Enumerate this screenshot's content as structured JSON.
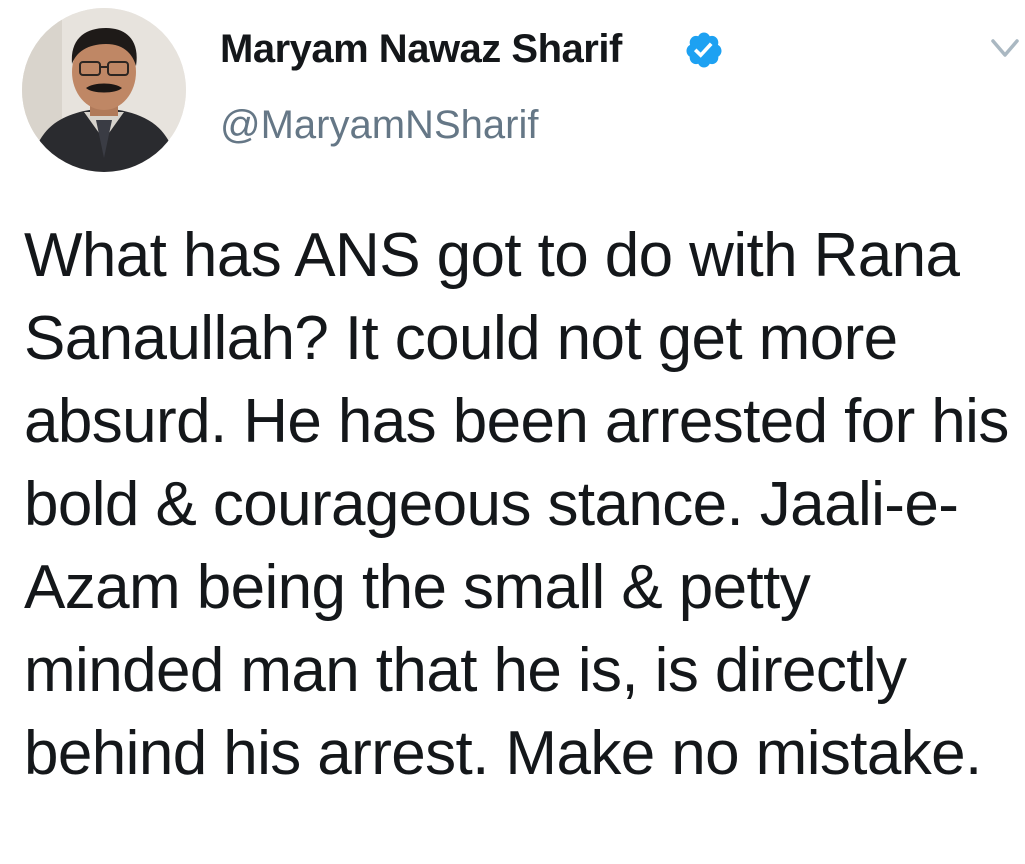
{
  "tweet": {
    "author": {
      "name": "Maryam Nawaz Sharif",
      "handle": "@MaryamNSharif",
      "verified": true
    },
    "text": "What has ANS got to do with Rana Sanaullah? It could not get more absurd. He has been arrested for his bold & courageous stance. Jaali-e-Azam being the small & petty minded man that he is, is directly behind his arrest. Make no mistake.",
    "icons": {
      "verified": "verified-badge-icon",
      "menu": "chevron-down-icon"
    },
    "colors": {
      "verified": "#1da1f2",
      "handle": "#657786",
      "text": "#14171a",
      "caret": "#aab8c2"
    }
  }
}
